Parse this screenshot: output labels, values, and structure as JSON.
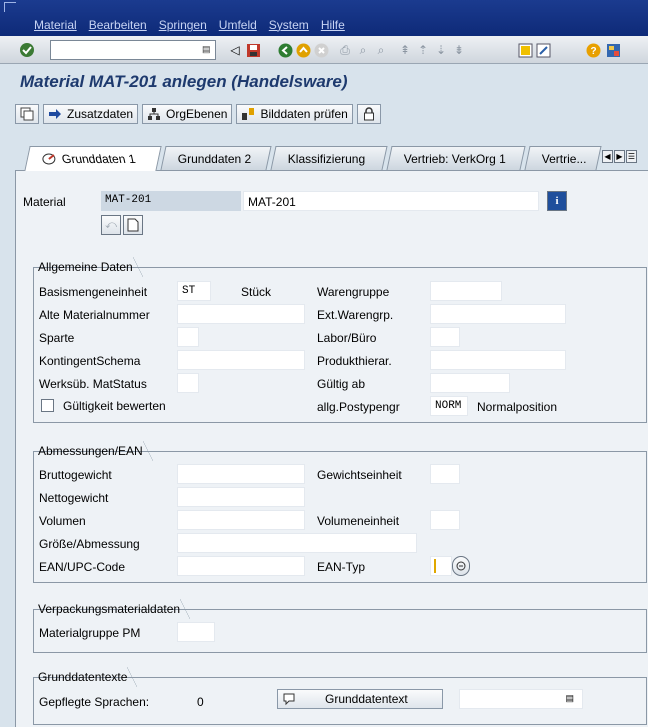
{
  "menu": {
    "items": [
      "Material",
      "Bearbeiten",
      "Springen",
      "Umfeld",
      "System",
      "Hilfe"
    ]
  },
  "toolbar": {
    "command_value": ""
  },
  "title": "Material MAT-201 anlegen (Handelsware)",
  "app_toolbar": {
    "zusatzdaten": "Zusatzdaten",
    "orgebenen": "OrgEbenen",
    "bilddaten": "Bilddaten prüfen"
  },
  "tabs": [
    {
      "label": "Grunddaten 1",
      "active": true
    },
    {
      "label": "Grunddaten 2"
    },
    {
      "label": "Klassifizierung"
    },
    {
      "label": "Vertrieb: VerkOrg 1"
    },
    {
      "label": "Vertrie..."
    }
  ],
  "header": {
    "material_label": "Material",
    "material_value": "MAT-201",
    "description_value": "MAT-201"
  },
  "allgemeine": {
    "title": "Allgemeine Daten",
    "basismengeneinheit_label": "Basismengeneinheit",
    "basismengeneinheit_value": "ST",
    "basismengeneinheit_text": "Stück",
    "alte_materialnummer_label": "Alte Materialnummer",
    "sparte_label": "Sparte",
    "kontingentschema_label": "KontingentSchema",
    "werksub_label": "Werksüb. MatStatus",
    "gueltigkeit_label": "Gültigkeit bewerten",
    "warengruppe_label": "Warengruppe",
    "ext_warengrp_label": "Ext.Warengrp.",
    "labor_label": "Labor/Büro",
    "produkthierar_label": "Produkthierar.",
    "gueltig_ab_label": "Gültig ab",
    "postypengr_label": "allg.Postypengr",
    "postypengr_value": "NORM",
    "postypengr_text": "Normalposition"
  },
  "abmessungen": {
    "title": "Abmessungen/EAN",
    "brutto_label": "Bruttogewicht",
    "netto_label": "Nettogewicht",
    "volumen_label": "Volumen",
    "groesse_label": "Größe/Abmessung",
    "ean_label": "EAN/UPC-Code",
    "gewichtseinheit_label": "Gewichtseinheit",
    "volumeneinheit_label": "Volumeneinheit",
    "eantyp_label": "EAN-Typ"
  },
  "verpackung": {
    "title": "Verpackungsmaterialdaten",
    "materialgruppe_label": "Materialgruppe PM"
  },
  "grunddatentexte": {
    "title": "Grunddatentexte",
    "sprachen_label": "Gepflegte Sprachen:",
    "sprachen_value": "0",
    "button_label": "Grunddatentext"
  },
  "colors": {
    "menubar": "#16348a",
    "title": "#1e3a6e",
    "panel": "#eef2f6",
    "readonly": "#cdd8e3"
  }
}
